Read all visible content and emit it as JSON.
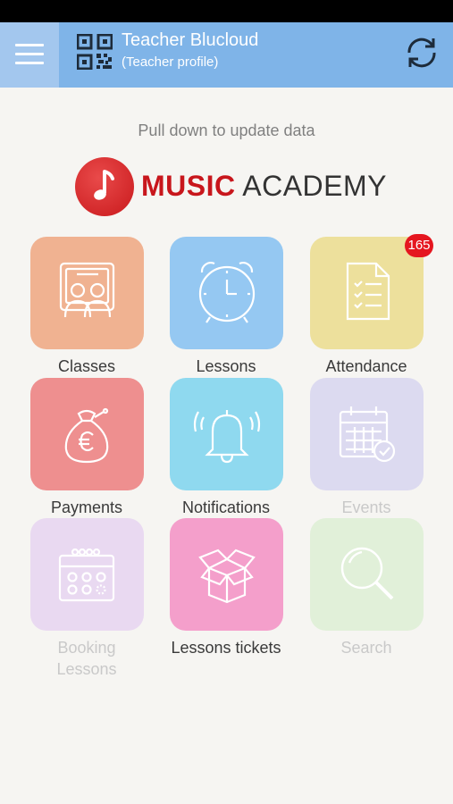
{
  "header": {
    "title": "Teacher Blucloud",
    "subtitle": "(Teacher profile)",
    "color": "#7fb4e8"
  },
  "hint": "Pull down to update data",
  "logo": {
    "music": "MUSIC",
    "academy": "ACADEMY"
  },
  "tiles": [
    {
      "label": "Classes",
      "icon": "classroom-icon",
      "color": "#f0b291",
      "enabled": true
    },
    {
      "label": "Lessons",
      "icon": "alarm-clock-icon",
      "color": "#95c8f2",
      "enabled": true
    },
    {
      "label": "Attendance",
      "icon": "checklist-document-icon",
      "color": "#ede09c",
      "enabled": true,
      "badge": "165"
    },
    {
      "label": "Payments",
      "icon": "euro-money-bag-icon",
      "color": "#ee8f8f",
      "enabled": true
    },
    {
      "label": "Notifications",
      "icon": "bell-icon",
      "color": "#8fd9ef",
      "enabled": true
    },
    {
      "label": "Events",
      "icon": "calendar-check-icon",
      "color": "#dcdaf0",
      "enabled": false
    },
    {
      "label": "Booking\nLessons",
      "label_line1": "Booking",
      "label_line2": "Lessons",
      "icon": "booking-calendar-icon",
      "color": "#e9d9f1",
      "enabled": false
    },
    {
      "label": "Lessons tickets",
      "icon": "open-box-icon",
      "color": "#f49fcb",
      "enabled": true
    },
    {
      "label": "Search",
      "icon": "magnifier-icon",
      "color": "#e1f0d9",
      "enabled": false
    }
  ]
}
